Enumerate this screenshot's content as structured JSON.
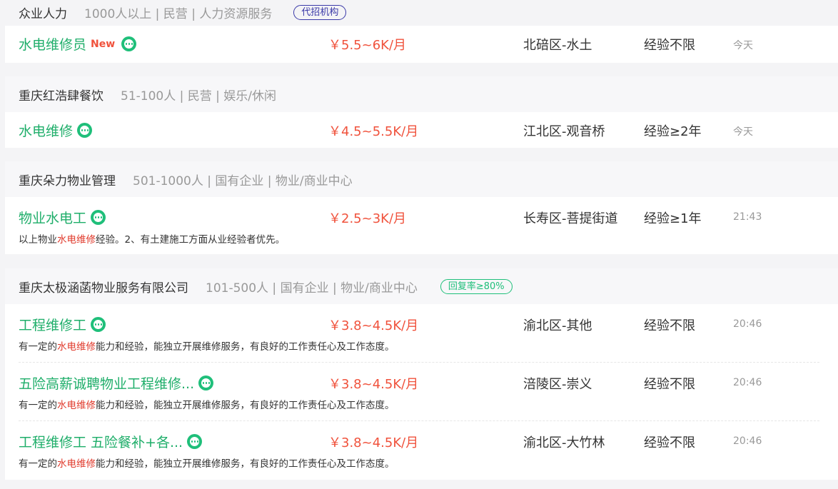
{
  "companies": [
    {
      "name": "众业人力",
      "meta": "1000人以上 | 民营 | 人力资源服务",
      "badge": "代招机构",
      "jobs": [
        {
          "title": "水电维修员",
          "new": "New",
          "salary": "￥5.5~6K/月",
          "location": "北碚区-水土",
          "experience": "经验不限",
          "time": "今天"
        }
      ]
    },
    {
      "name": "重庆红浩肆餐饮",
      "meta": "51-100人 | 民营 | 娱乐/休闲",
      "jobs": [
        {
          "title": "水电维修",
          "salary": "￥4.5~5.5K/月",
          "location": "江北区-观音桥",
          "experience": "经验≥2年",
          "time": "今天"
        }
      ]
    },
    {
      "name": "重庆朵力物业管理",
      "meta": "501-1000人 | 国有企业 | 物业/商业中心",
      "jobs": [
        {
          "title": "物业水电工",
          "salary": "￥2.5~3K/月",
          "location": "长寿区-菩提街道",
          "experience": "经验≥1年",
          "time": "21:43",
          "desc_before": "以上物业",
          "desc_highlight": "水电维修",
          "desc_after": "经验。2、有土建施工方面从业经验者优先。"
        }
      ]
    },
    {
      "name": "重庆太极涵菡物业服务有限公司",
      "meta": "101-500人 | 国有企业 | 物业/商业中心",
      "badge": "回复率≥80%",
      "jobs": [
        {
          "title": "工程维修工",
          "salary": "￥3.8~4.5K/月",
          "location": "渝北区-其他",
          "experience": "经验不限",
          "time": "20:46",
          "desc_before": "有一定的",
          "desc_highlight": "水电维修",
          "desc_after": "能力和经验，能独立开展维修服务，有良好的工作责任心及工作态度。"
        },
        {
          "title": "五险高薪诚聘物业工程维修...",
          "salary": "￥3.8~4.5K/月",
          "location": "涪陵区-崇义",
          "experience": "经验不限",
          "time": "20:46",
          "desc_before": "有一定的",
          "desc_highlight": "水电维修",
          "desc_after": "能力和经验，能独立开展维修服务，有良好的工作责任心及工作态度。"
        },
        {
          "title": "工程维修工 五险餐补+各...",
          "salary": "￥3.8~4.5K/月",
          "location": "渝北区-大竹林",
          "experience": "经验不限",
          "time": "20:46",
          "desc_before": "有一定的",
          "desc_highlight": "水电维修",
          "desc_after": "能力和经验，能独立开展维修服务，有良好的工作责任心及工作态度。"
        }
      ]
    }
  ],
  "icons": {
    "chat": "chat-bubble-icon"
  },
  "colors": {
    "title": "#1fae6a",
    "salary": "#f0523c",
    "highlight": "#e0382a",
    "badge_purple": "#3a39a8",
    "badge_green": "#1fbf7a"
  }
}
